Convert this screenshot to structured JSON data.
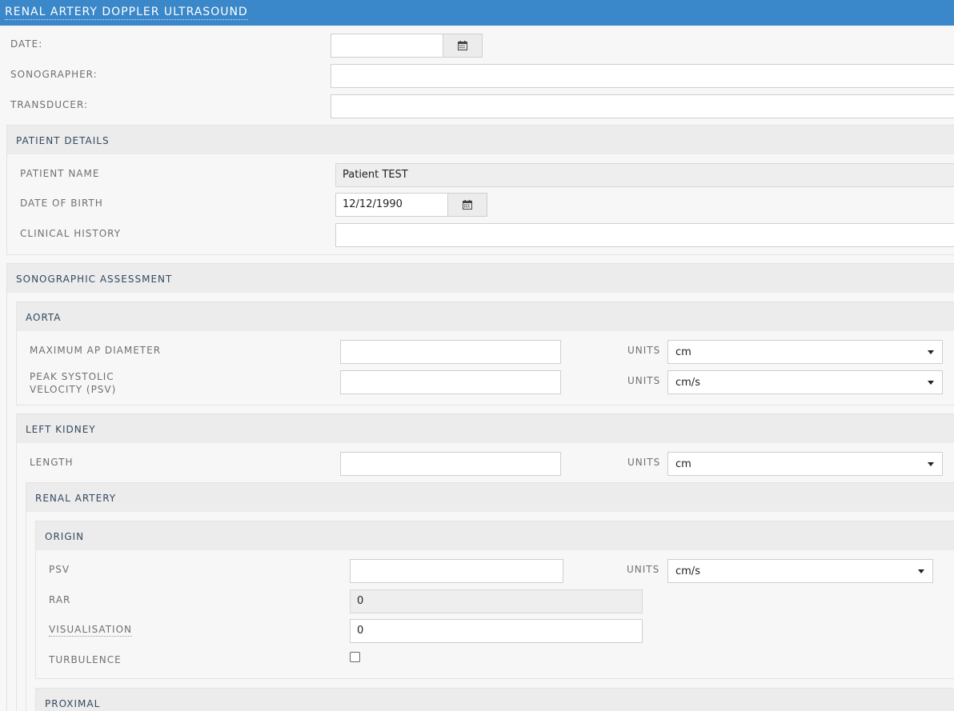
{
  "title": "RENAL ARTERY DOPPLER ULTRASOUND",
  "header_fields": {
    "date_label": "DATE:",
    "date_value": "",
    "sonographer_label": "SONOGRAPHER:",
    "sonographer_value": "",
    "transducer_label": "TRANSDUCER:",
    "transducer_value": ""
  },
  "patient_details": {
    "heading": "PATIENT DETAILS",
    "name_label": "PATIENT NAME",
    "name_value": "Patient TEST",
    "dob_label": "DATE OF BIRTH",
    "dob_value": "12/12/1990",
    "history_label": "CLINICAL HISTORY",
    "history_value": ""
  },
  "assessment": {
    "heading": "SONOGRAPHIC ASSESSMENT",
    "aorta": {
      "heading": "AORTA",
      "max_ap_label": "MAXIMUM AP DIAMETER",
      "max_ap_value": "",
      "max_ap_units_label": "UNITS",
      "max_ap_units": "cm",
      "psv_label_line1": "PEAK SYSTOLIC",
      "psv_label_line2": "VELOCITY (PSV)",
      "psv_value": "",
      "psv_units_label": "UNITS",
      "psv_units": "cm/s"
    },
    "left_kidney": {
      "heading": "LEFT KIDNEY",
      "length_label": "LENGTH",
      "length_value": "",
      "length_units_label": "UNITS",
      "length_units": "cm",
      "renal_artery": {
        "heading": "RENAL ARTERY",
        "origin": {
          "heading": "ORIGIN",
          "psv_label": "PSV",
          "psv_value": "",
          "psv_units_label": "UNITS",
          "psv_units": "cm/s",
          "rar_label": "RAR",
          "rar_value": "0",
          "visualisation_label": "VISUALISATION",
          "visualisation_value": "0",
          "turbulence_label": "TURBULENCE",
          "turbulence_checked": false
        },
        "proximal": {
          "heading": "PROXIMAL"
        }
      }
    }
  },
  "colors": {
    "title_bar": "#3a87c9",
    "section_header": "#ececec",
    "page_bg": "#f7f7f7"
  },
  "icons": {
    "calendar": "calendar-icon",
    "dropdown": "chevron-down-icon"
  }
}
